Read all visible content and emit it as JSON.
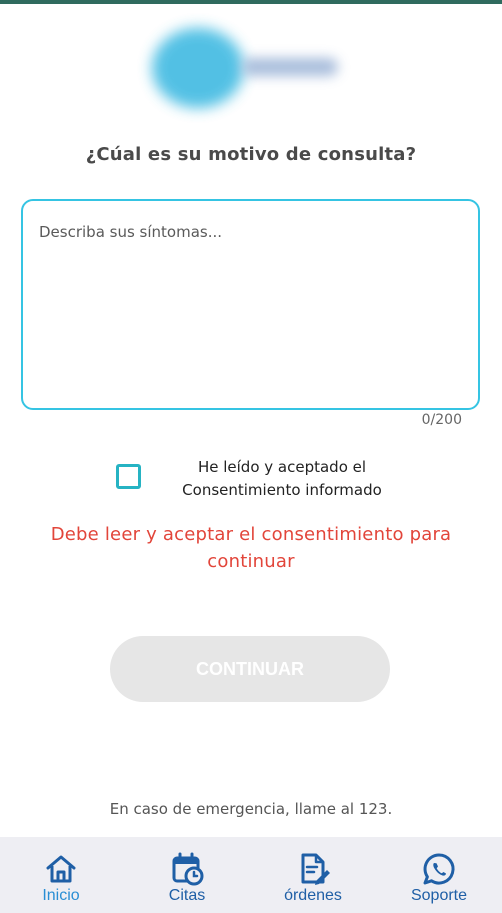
{
  "form": {
    "question": "¿Cúal es su motivo de consulta?",
    "symptoms_placeholder": "Describa sus síntomas...",
    "symptoms_value": "",
    "char_counter": "0/200",
    "consent_label": "He leído y aceptado el Consentimiento informado",
    "consent_checked": false,
    "error_message": "Debe leer y aceptar el consentimiento para continuar",
    "continue_label": "CONTINUAR"
  },
  "footer": {
    "emergency_text": "En caso de emergencia, llame al 123."
  },
  "bottom_nav": {
    "items": [
      {
        "label": "Inicio",
        "icon": "home-icon",
        "active": true
      },
      {
        "label": "Citas",
        "icon": "calendar-clock-icon",
        "active": false
      },
      {
        "label": "órdenes",
        "icon": "document-edit-icon",
        "active": false
      },
      {
        "label": "Soporte",
        "icon": "whatsapp-icon",
        "active": false
      }
    ]
  },
  "colors": {
    "accent_border": "#35c4e3",
    "checkbox": "#26b3c3",
    "error": "#e2453a",
    "nav_label": "#1f5fa6",
    "nav_active": "#2a8ed4",
    "button_disabled": "#e6e6e6"
  }
}
